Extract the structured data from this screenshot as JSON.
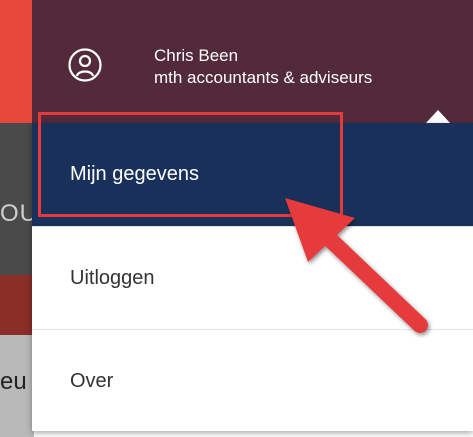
{
  "account": {
    "name": "Chris Been",
    "company": "mth accountants & adviseurs"
  },
  "menu": {
    "items": [
      {
        "label": "Mijn gegevens"
      },
      {
        "label": "Uitloggen"
      },
      {
        "label": "Over"
      }
    ]
  },
  "background": {
    "fragment_top": "OU",
    "fragment_bottom": "eu"
  },
  "colors": {
    "header_bg": "#522a39",
    "active_item_bg": "#19315a",
    "annotation_red": "#e53a3c",
    "page_accent_red": "#e8473b"
  }
}
